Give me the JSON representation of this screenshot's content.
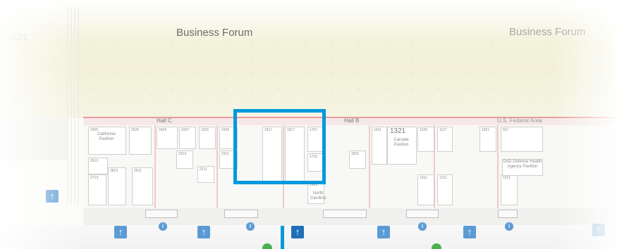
{
  "map": {
    "court_label": "ourt",
    "business_forum_left": "Business Forum",
    "business_forum_right": "Business Forum",
    "hall_c": "Hall C",
    "hall_b": "Hall B",
    "us_federal_area": "U.S. Federal Area",
    "booths": [
      "2425",
      "2525",
      "2425",
      "2327",
      "2325",
      "2425",
      "1917",
      "1817",
      "1707",
      "1421",
      "1321",
      "1225",
      "1127",
      "1021",
      "917",
      "2313",
      "2311",
      "2211",
      "1715",
      "1815",
      "1311",
      "1211",
      "1011",
      "2613",
      "2813",
      "2611",
      "2713",
      "1905"
    ],
    "pavilions": [
      "California Pavilion",
      "Canada Pavilion",
      "DoD Defense Health Agency Pavilion",
      "North Carolina"
    ],
    "highlight_color": "#0099dd",
    "arrow_icon": "arrow-up-icon",
    "info_icon": "info-icon"
  }
}
